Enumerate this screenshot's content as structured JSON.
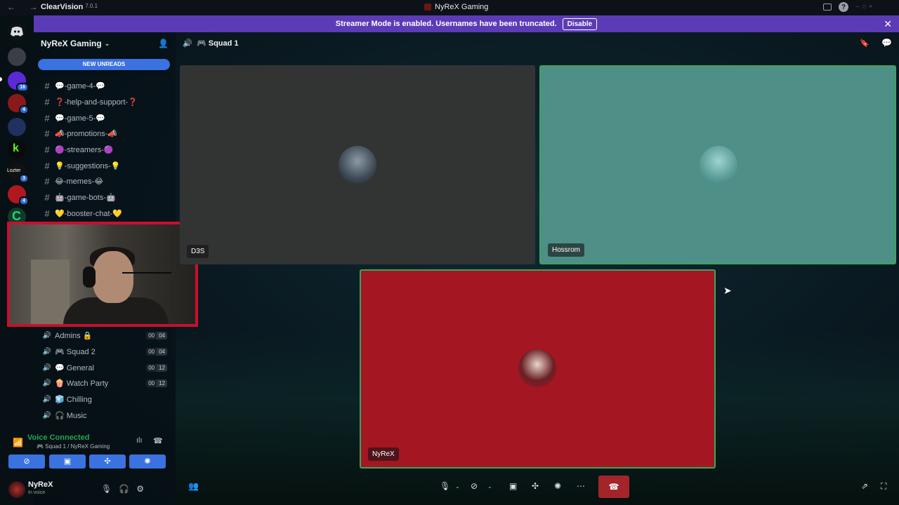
{
  "titlebar": {
    "nav": "← →",
    "app_name": "ClearVision",
    "app_version": "7.0.1",
    "window_title": "NyReX Gaming",
    "right_icons": [
      "screen-share-icon",
      "help-icon"
    ]
  },
  "banner": {
    "message": "Streamer Mode is enabled. Usernames have been truncated.",
    "button": "Disable",
    "close": "✕"
  },
  "server": {
    "name": "NyReX Gaming",
    "new_unreads": "NEW UNREADS"
  },
  "text_channels": [
    {
      "name": "💬-game-4-💬"
    },
    {
      "name": "❓-help-and-support-❓"
    },
    {
      "name": "💬-game-5-💬"
    },
    {
      "name": "📣-promotions-📣"
    },
    {
      "name": "🟣-streamers-🟣"
    },
    {
      "name": "💡-suggestions-💡"
    },
    {
      "name": "😂-memes-😂"
    },
    {
      "name": "🤖-game-bots-🤖"
    },
    {
      "name": "💛-booster-chat-💛"
    }
  ],
  "voice_channels": [
    {
      "name": "Admins 🔒",
      "c1": "00",
      "c2": "04"
    },
    {
      "name": "🎮 Squad 2",
      "c1": "00",
      "c2": "04"
    },
    {
      "name": "💬 General",
      "c1": "00",
      "c2": "12"
    },
    {
      "name": "🍿 Watch Party",
      "c1": "00",
      "c2": "12"
    },
    {
      "name": "🧊 Chilling",
      "c1": "",
      "c2": ""
    },
    {
      "name": "🎧 Music",
      "c1": "",
      "c2": ""
    }
  ],
  "voice_status": {
    "status": "Voice Connected",
    "location": "🎮 Squad 1 / NyReX Gaming"
  },
  "user": {
    "name": "NyReX",
    "status": "In voice"
  },
  "voice_room": {
    "title": "🎮 Squad 1",
    "participants": [
      {
        "name": "D3S"
      },
      {
        "name": "Hossrom"
      },
      {
        "name": "NyReX"
      }
    ]
  },
  "rail_badges": [
    "16",
    "4",
    "3",
    "4"
  ],
  "colors": {
    "banner": "#5c3bb6",
    "accent": "#3a72e0",
    "connected": "#23a55a",
    "hangup": "#a3252a",
    "webcam_border": "#c8102e"
  }
}
